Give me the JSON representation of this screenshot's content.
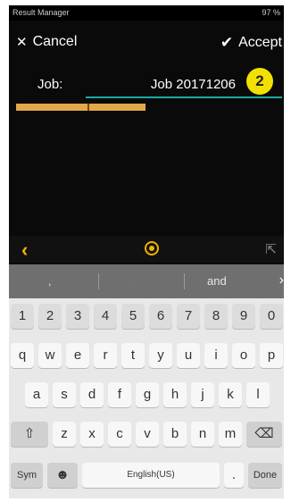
{
  "status_bar": {
    "app_name": "Result Manager",
    "battery": "97 %"
  },
  "header": {
    "cancel_label": "Cancel",
    "accept_label": "Accept"
  },
  "job": {
    "label": "Job:",
    "value": "Job 20171206"
  },
  "badge": "2",
  "progress": {
    "fill_fraction": 0.47
  },
  "toolbar": {
    "back_icon": "chevron-left-icon",
    "center_icon": "target-icon",
    "share_icon": "share-icon"
  },
  "keyboard": {
    "suggestions": [
      ",",
      ".",
      "and"
    ],
    "row_numbers": [
      "1",
      "2",
      "3",
      "4",
      "5",
      "6",
      "7",
      "8",
      "9",
      "0"
    ],
    "row1": [
      "q",
      "w",
      "e",
      "r",
      "t",
      "y",
      "u",
      "i",
      "o",
      "p"
    ],
    "row2": [
      "a",
      "s",
      "d",
      "f",
      "g",
      "h",
      "j",
      "k",
      "l"
    ],
    "row3": [
      "z",
      "x",
      "c",
      "v",
      "b",
      "n",
      "m"
    ],
    "shift": "⇧",
    "backspace": "⌫",
    "sym": "Sym",
    "emoji": "☻",
    "space_label": "English(US)",
    "period": ".",
    "done": "Done",
    "next_arrow": "›"
  }
}
